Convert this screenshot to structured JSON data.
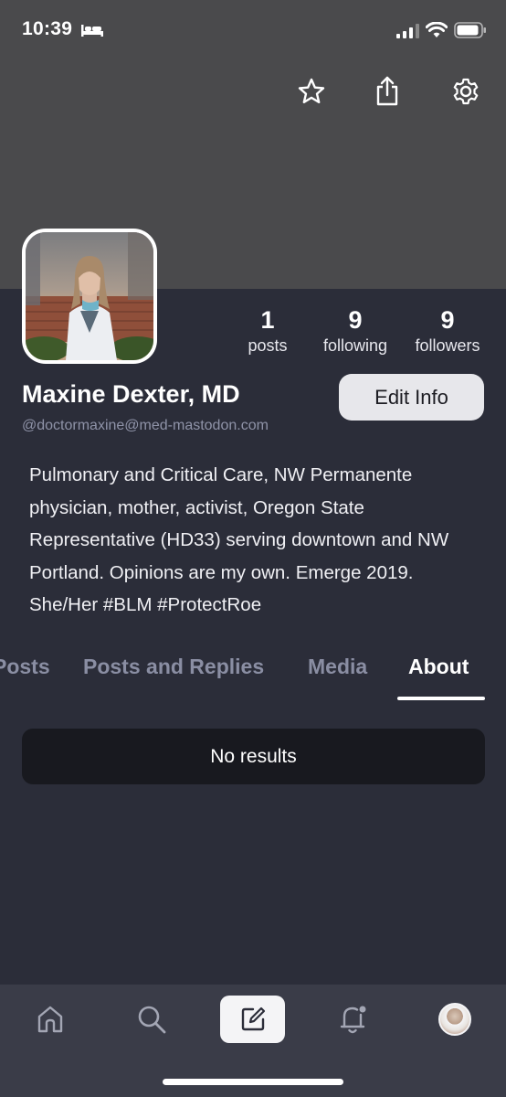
{
  "status_bar": {
    "time": "10:39"
  },
  "header": {
    "actions": [
      "favorite",
      "share",
      "settings"
    ]
  },
  "profile": {
    "display_name": "Maxine Dexter, MD",
    "handle": "@doctormaxine@med-mastodon.com",
    "edit_button_label": "Edit Info",
    "bio": "Pulmonary and Critical Care, NW Permanente physician, mother, activist, Oregon State Representative (HD33) serving downtown and NW Portland. Opinions are my own. Emerge 2019. She/Her #BLM #ProtectRoe",
    "stats": {
      "posts": {
        "value": "1",
        "label": "posts"
      },
      "following": {
        "value": "9",
        "label": "following"
      },
      "followers": {
        "value": "9",
        "label": "followers"
      }
    }
  },
  "tabs": [
    {
      "label": "Posts",
      "active": false
    },
    {
      "label": "Posts and Replies",
      "active": false
    },
    {
      "label": "Media",
      "active": false
    },
    {
      "label": "About",
      "active": true
    }
  ],
  "content": {
    "empty_message": "No results"
  },
  "bottom_nav": {
    "items": [
      "home-icon",
      "search-icon",
      "compose-icon",
      "notifications-icon",
      "profile-avatar"
    ]
  },
  "colors": {
    "background": "#2b2d39",
    "banner": "#4a4a4c",
    "tab_inactive": "#8a8ea3",
    "handle": "#8f93a8",
    "bottom_nav": "#3a3c48"
  }
}
